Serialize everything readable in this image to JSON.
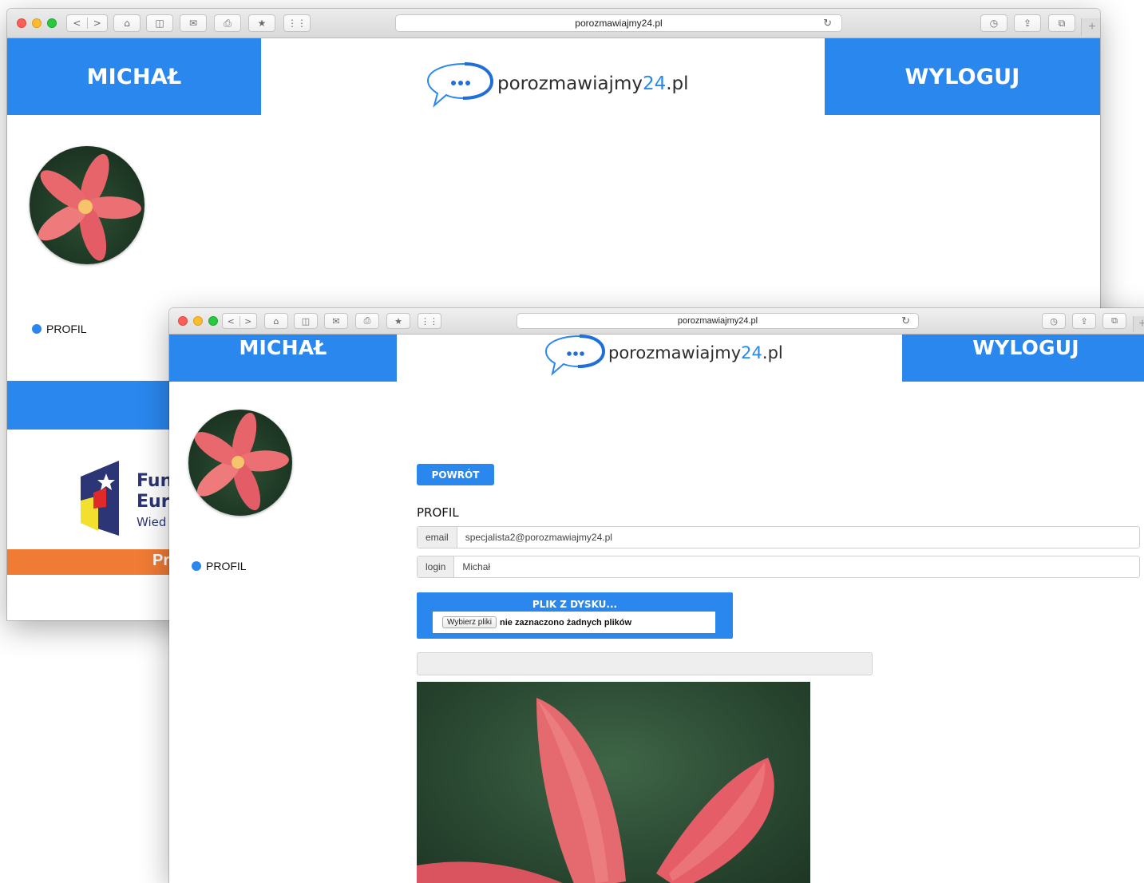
{
  "browser": {
    "url": "porozmawiajmy24.pl",
    "nav_back": "<",
    "nav_forward": ">",
    "new_tab": "+"
  },
  "header": {
    "user_label": "MICHAŁ",
    "logout_label": "WYLOGUJ",
    "logo_main": "porozmawiajmy",
    "logo_accent": "24",
    "logo_suffix": ".pl",
    "logo_bubble": "..."
  },
  "sidebar": {
    "items": [
      {
        "label": "PROFIL"
      }
    ]
  },
  "footer": {
    "eu_line1": "Fun",
    "eu_line2": "Eur",
    "eu_line3": "Wied",
    "orange_text": "Pr"
  },
  "profile": {
    "back_button": "POWRÓT",
    "title": "PROFIL",
    "fields": [
      {
        "label": "email",
        "value": "specjalista2@porozmawiajmy24.pl"
      },
      {
        "label": "login",
        "value": "Michał"
      }
    ],
    "upload": {
      "title": "PLIK Z DYSKU...",
      "choose_button": "Wybierz pliki",
      "status": "nie zaznaczono żadnych plików"
    },
    "upload_progress": 0
  },
  "colors": {
    "primary": "#2a87ee",
    "orange": "#ef7b35",
    "eu_navy": "#2c3575"
  }
}
